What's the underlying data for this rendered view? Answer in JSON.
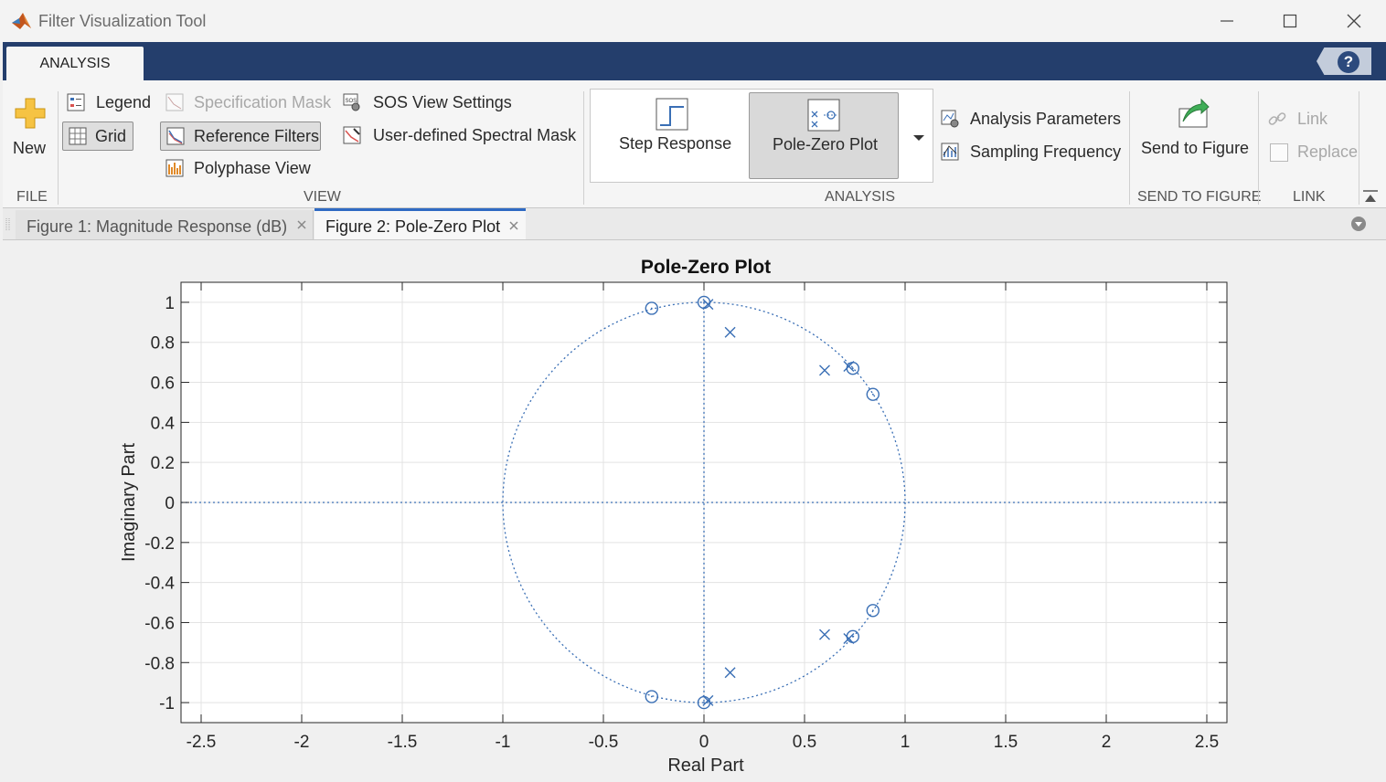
{
  "window": {
    "title": "Filter Visualization Tool",
    "controls": [
      "minimize-icon",
      "maximize-icon",
      "close-icon"
    ]
  },
  "ribbon": {
    "tab": "ANALYSIS",
    "help_icon": "?",
    "file": {
      "new_label": "New",
      "section_label": "FILE"
    },
    "view": {
      "legend": "Legend",
      "grid": "Grid",
      "specification_mask": "Specification Mask",
      "reference_filters": "Reference Filters",
      "polyphase_view": "Polyphase View",
      "sos_view_settings": "SOS View Settings",
      "user_defined_spectral_mask": "User-defined Spectral Mask",
      "section_label": "VIEW"
    },
    "analysis": {
      "step_response": "Step Response",
      "pole_zero_plot": "Pole-Zero Plot",
      "analysis_parameters": "Analysis Parameters",
      "sampling_frequency": "Sampling Frequency",
      "section_label": "ANALYSIS"
    },
    "send_to_figure": {
      "label": "Send to Figure",
      "section_label": "SEND TO FIGURE"
    },
    "link": {
      "link": "Link",
      "replace": "Replace",
      "section_label": "LINK"
    }
  },
  "documents": {
    "tabs": [
      {
        "label": "Figure 1: Magnitude Response (dB)",
        "active": false
      },
      {
        "label": "Figure 2: Pole-Zero Plot",
        "active": true
      }
    ]
  },
  "colors": {
    "ribbon_header": "#243e6c",
    "plot_marker": "#3a6fb5",
    "active_tab_accent": "#2f6ac3"
  },
  "chart_data": {
    "type": "scatter",
    "title": "Pole-Zero Plot",
    "xlabel": "Real Part",
    "ylabel": "Imaginary Part",
    "xlim": [
      -2.6,
      2.6
    ],
    "ylim": [
      -1.1,
      1.1
    ],
    "xticks": [
      -2.5,
      -2,
      -1.5,
      -1,
      -0.5,
      0,
      0.5,
      1,
      1.5,
      2,
      2.5
    ],
    "xtick_labels": [
      "-2.5",
      "-2",
      "-1.5",
      "-1",
      "-0.5",
      "0",
      "0.5",
      "1",
      "1.5",
      "2",
      "2.5"
    ],
    "yticks": [
      1,
      0.8,
      0.6,
      0.4,
      0.2,
      0,
      -0.2,
      -0.4,
      -0.6,
      -0.8,
      -1
    ],
    "ytick_labels": [
      "1",
      "0.8",
      "0.6",
      "0.4",
      "0.2",
      "0",
      "-0.2",
      "-0.4",
      "-0.6",
      "-0.8",
      "-1"
    ],
    "grid": true,
    "unit_circle": true,
    "series": [
      {
        "marker": "o",
        "points": [
          [
            -0.26,
            0.97
          ],
          [
            0.0,
            1.0
          ],
          [
            0.74,
            0.67
          ],
          [
            0.84,
            0.54
          ],
          [
            -0.26,
            -0.97
          ],
          [
            0.0,
            -1.0
          ],
          [
            0.74,
            -0.67
          ],
          [
            0.84,
            -0.54
          ]
        ]
      },
      {
        "marker": "x",
        "points": [
          [
            0.02,
            0.99
          ],
          [
            0.13,
            0.85
          ],
          [
            0.6,
            0.66
          ],
          [
            0.72,
            0.68
          ],
          [
            0.02,
            -0.99
          ],
          [
            0.13,
            -0.85
          ],
          [
            0.6,
            -0.66
          ],
          [
            0.72,
            -0.68
          ]
        ]
      }
    ]
  }
}
